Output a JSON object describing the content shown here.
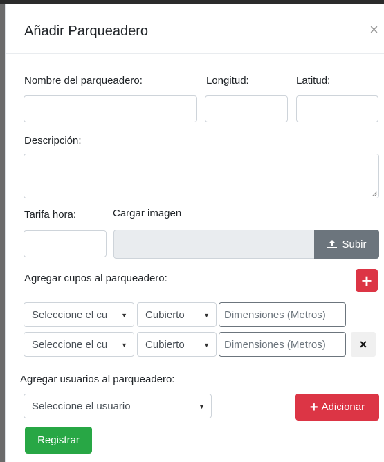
{
  "modal": {
    "title": "Añadir Parqueadero",
    "close_label": "×"
  },
  "form": {
    "name_label": "Nombre del parqueadero:",
    "longitude_label": "Longitud:",
    "latitude_label": "Latitud:",
    "description_label": "Descripción:",
    "rate_label": "Tarifa hora:",
    "image_label": "Cargar imagen",
    "upload_label": "Subir",
    "slots_label": "Agregar cupos al parqueadero:",
    "users_label": "Agregar usuarios al parqueadero:"
  },
  "slots": [
    {
      "type_select": "Seleccione el cu",
      "cover_select": "Cubierto",
      "dimensions_placeholder": "Dimensiones (Metros)"
    },
    {
      "type_select": "Seleccione el cu",
      "cover_select": "Cubierto",
      "dimensions_placeholder": "Dimensiones (Metros)",
      "remove_label": "×"
    }
  ],
  "users": {
    "select_value": "Seleccione el usuario",
    "add_label": "Adicionar"
  },
  "actions": {
    "submit_label": "Registrar"
  },
  "icons": {
    "add_slot": "plus-icon",
    "upload": "upload-icon",
    "caret": "caret-down-icon"
  },
  "colors": {
    "danger": "#dc3545",
    "success": "#28a745",
    "secondary": "#6c757d"
  }
}
